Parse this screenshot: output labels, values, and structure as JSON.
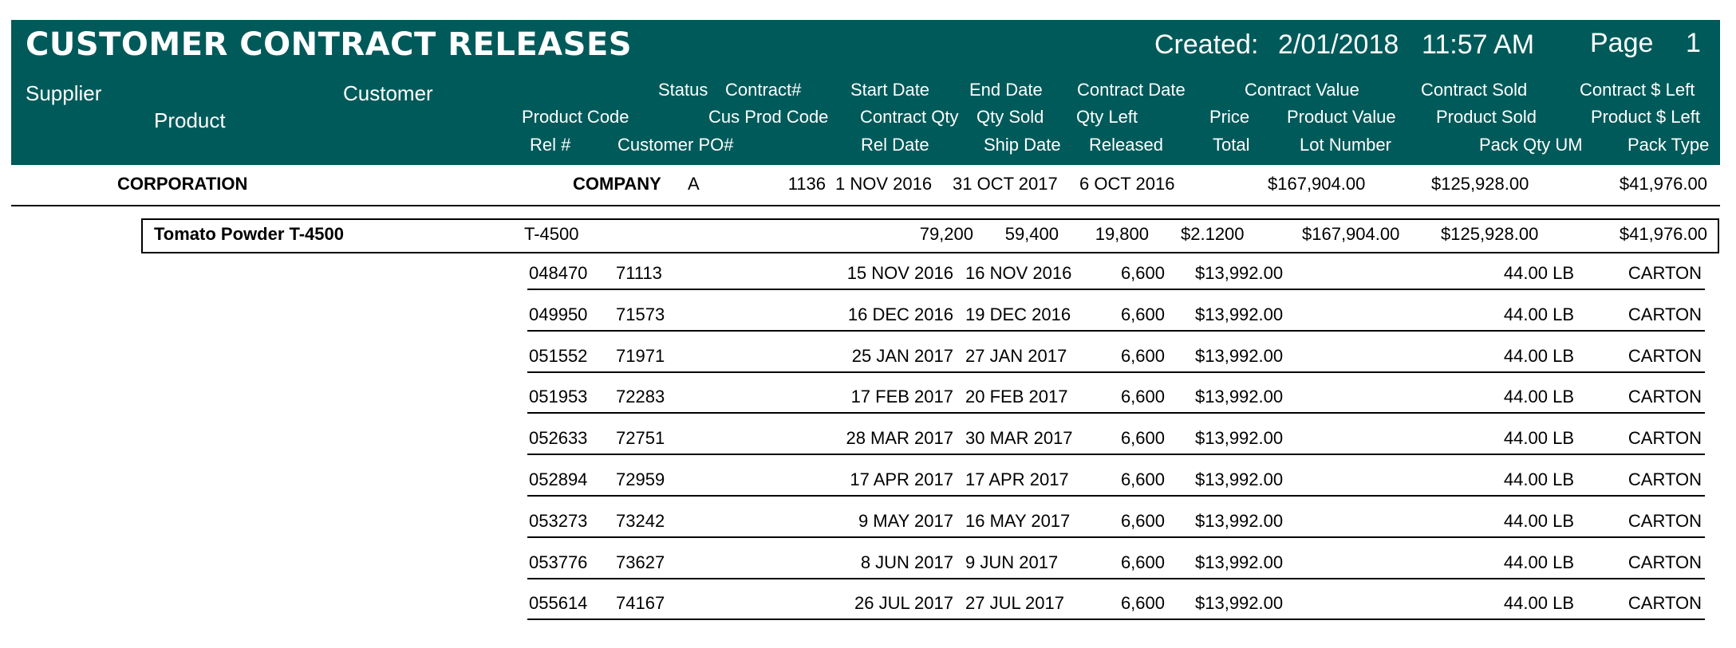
{
  "report": {
    "title": "CUSTOMER CONTRACT RELEASES",
    "created_label": "Created:",
    "created_date": "2/01/2018",
    "created_time": "11:57 AM",
    "page_label": "Page",
    "page_number": "1"
  },
  "columns": {
    "supplier": "Supplier",
    "customer": "Customer",
    "product": "Product",
    "status": "Status",
    "contract_no": "Contract#",
    "start_date": "Start Date",
    "end_date": "End Date",
    "contract_date": "Contract Date",
    "contract_value": "Contract Value",
    "contract_sold": "Contract Sold",
    "contract_left": "Contract $ Left",
    "product_code": "Product Code",
    "cus_prod_code": "Cus Prod Code",
    "contract_qty": "Contract Qty",
    "qty_sold": "Qty Sold",
    "qty_left": "Qty Left",
    "price": "Price",
    "product_value": "Product Value",
    "product_sold": "Product Sold",
    "product_left": "Product $ Left",
    "rel_no": "Rel #",
    "customer_po": "Customer PO#",
    "rel_date": "Rel Date",
    "ship_date": "Ship Date",
    "released": "Released",
    "total": "Total",
    "lot_number": "Lot Number",
    "pack_qty_um": "Pack Qty UM",
    "pack_type": "Pack Type"
  },
  "contract": {
    "supplier": "CORPORATION",
    "customer": "COMPANY",
    "status": "A",
    "contract_no": "1136",
    "start_date": "1 NOV 2016",
    "end_date": "31 OCT 2017",
    "contract_date": "6 OCT 2016",
    "contract_value": "$167,904.00",
    "contract_sold": "$125,928.00",
    "contract_left": "$41,976.00"
  },
  "product": {
    "name": "Tomato Powder T-4500",
    "code": "T-4500",
    "contract_qty": "79,200",
    "qty_sold": "59,400",
    "qty_left": "19,800",
    "price": "$2.1200",
    "product_value": "$167,904.00",
    "product_sold": "$125,928.00",
    "product_left": "$41,976.00"
  },
  "releases": [
    {
      "rel": "048470",
      "po": "71113",
      "rel_date": "15 NOV 2016",
      "ship_date": "16 NOV 2016",
      "released": "6,600",
      "total": "$13,992.00",
      "pack_qty_um": "44.00 LB",
      "pack_type": "CARTON"
    },
    {
      "rel": "049950",
      "po": "71573",
      "rel_date": "16 DEC 2016",
      "ship_date": "19 DEC 2016",
      "released": "6,600",
      "total": "$13,992.00",
      "pack_qty_um": "44.00 LB",
      "pack_type": "CARTON"
    },
    {
      "rel": "051552",
      "po": "71971",
      "rel_date": "25 JAN 2017",
      "ship_date": "27 JAN 2017",
      "released": "6,600",
      "total": "$13,992.00",
      "pack_qty_um": "44.00 LB",
      "pack_type": "CARTON"
    },
    {
      "rel": "051953",
      "po": "72283",
      "rel_date": "17 FEB 2017",
      "ship_date": "20 FEB 2017",
      "released": "6,600",
      "total": "$13,992.00",
      "pack_qty_um": "44.00 LB",
      "pack_type": "CARTON"
    },
    {
      "rel": "052633",
      "po": "72751",
      "rel_date": "28 MAR 2017",
      "ship_date": "30 MAR 2017",
      "released": "6,600",
      "total": "$13,992.00",
      "pack_qty_um": "44.00 LB",
      "pack_type": "CARTON"
    },
    {
      "rel": "052894",
      "po": "72959",
      "rel_date": "17 APR 2017",
      "ship_date": "17 APR 2017",
      "released": "6,600",
      "total": "$13,992.00",
      "pack_qty_um": "44.00 LB",
      "pack_type": "CARTON"
    },
    {
      "rel": "053273",
      "po": "73242",
      "rel_date": "9 MAY 2017",
      "ship_date": "16 MAY 2017",
      "released": "6,600",
      "total": "$13,992.00",
      "pack_qty_um": "44.00 LB",
      "pack_type": "CARTON"
    },
    {
      "rel": "053776",
      "po": "73627",
      "rel_date": "8 JUN 2017",
      "ship_date": "9 JUN 2017",
      "released": "6,600",
      "total": "$13,992.00",
      "pack_qty_um": "44.00 LB",
      "pack_type": "CARTON"
    },
    {
      "rel": "055614",
      "po": "74167",
      "rel_date": "26 JUL 2017",
      "ship_date": "27 JUL 2017",
      "released": "6,600",
      "total": "$13,992.00",
      "pack_qty_um": "44.00 LB",
      "pack_type": "CARTON"
    }
  ]
}
